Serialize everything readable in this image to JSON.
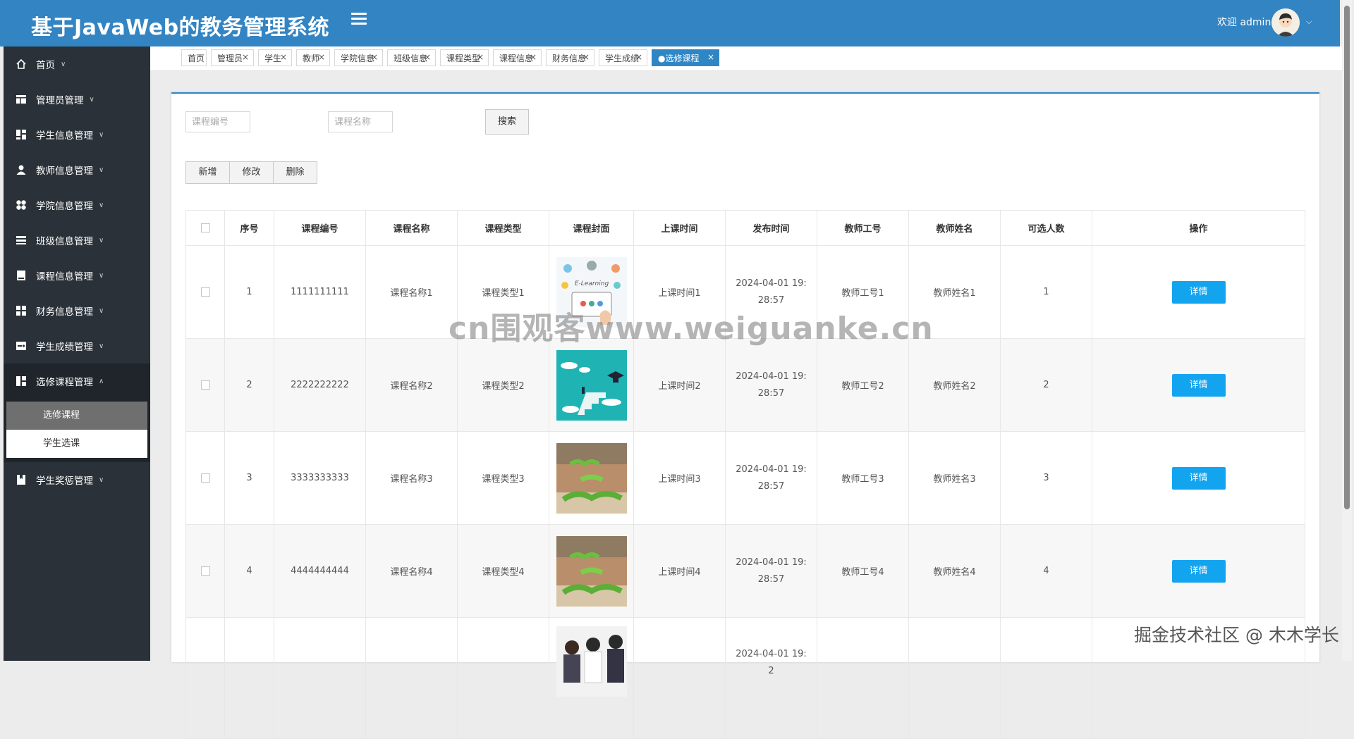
{
  "header": {
    "title": "基于JavaWeb的教务管理系统",
    "welcome": "欢迎 admin"
  },
  "sidebar": {
    "items": [
      {
        "label": "首页",
        "icon": "home-icon"
      },
      {
        "label": "管理员管理",
        "icon": "table-icon"
      },
      {
        "label": "学生信息管理",
        "icon": "dashboard-icon"
      },
      {
        "label": "教师信息管理",
        "icon": "user-icon"
      },
      {
        "label": "学院信息管理",
        "icon": "circles-icon"
      },
      {
        "label": "班级信息管理",
        "icon": "list-icon"
      },
      {
        "label": "课程信息管理",
        "icon": "book-icon"
      },
      {
        "label": "财务信息管理",
        "icon": "grid-icon"
      },
      {
        "label": "学生成绩管理",
        "icon": "chart-icon"
      },
      {
        "label": "选修课程管理",
        "icon": "layout-icon"
      },
      {
        "label": "学生奖惩管理",
        "icon": "bookmark-icon"
      }
    ],
    "submenu": [
      "选修课程",
      "学生选课"
    ]
  },
  "tabs": [
    {
      "label": "首页"
    },
    {
      "label": "管理员"
    },
    {
      "label": "学生"
    },
    {
      "label": "教师"
    },
    {
      "label": "学院信息"
    },
    {
      "label": "班级信息"
    },
    {
      "label": "课程类型"
    },
    {
      "label": "课程信息"
    },
    {
      "label": "财务信息"
    },
    {
      "label": "学生成绩"
    },
    {
      "label": "●选修课程"
    }
  ],
  "search": {
    "course_no_placeholder": "课程编号",
    "course_name_placeholder": "课程名称",
    "button": "搜索"
  },
  "actions": {
    "add": "新增",
    "edit": "修改",
    "delete": "删除"
  },
  "table": {
    "columns": [
      "序号",
      "课程编号",
      "课程名称",
      "课程类型",
      "课程封面",
      "上课时间",
      "发布时间",
      "教师工号",
      "教师姓名",
      "可选人数",
      "操作"
    ],
    "detail_label": "详情",
    "rows": [
      {
        "idx": "1",
        "course_no": "1111111111",
        "name": "课程名称1",
        "type": "课程类型1",
        "time": "上课时间1",
        "published": "2024-04-01 19:28:57",
        "teacher_no": "教师工号1",
        "teacher_name": "教师姓名1",
        "seats": "1"
      },
      {
        "idx": "2",
        "course_no": "2222222222",
        "name": "课程名称2",
        "type": "课程类型2",
        "time": "上课时间2",
        "published": "2024-04-01 19:28:57",
        "teacher_no": "教师工号2",
        "teacher_name": "教师姓名2",
        "seats": "2"
      },
      {
        "idx": "3",
        "course_no": "3333333333",
        "name": "课程名称3",
        "type": "课程类型3",
        "time": "上课时间3",
        "published": "2024-04-01 19:28:57",
        "teacher_no": "教师工号3",
        "teacher_name": "教师姓名3",
        "seats": "3"
      },
      {
        "idx": "4",
        "course_no": "4444444444",
        "name": "课程名称4",
        "type": "课程类型4",
        "time": "上课时间4",
        "published": "2024-04-01 19:28:57",
        "teacher_no": "教师工号4",
        "teacher_name": "教师姓名4",
        "seats": "4"
      },
      {
        "idx": "",
        "course_no": "",
        "name": "",
        "type": "",
        "time": "",
        "published": "2024-04-01 19:2",
        "teacher_no": "",
        "teacher_name": "",
        "seats": ""
      }
    ]
  },
  "watermarks": {
    "center": "cn围观客www.weiguanke.cn",
    "corner": "掘金技术社区 @ 木木学长"
  },
  "colors": {
    "header": "#3384c2",
    "sidebar": "#2a3138",
    "accent": "#2f86c4",
    "detail_button": "#13a4f0"
  }
}
